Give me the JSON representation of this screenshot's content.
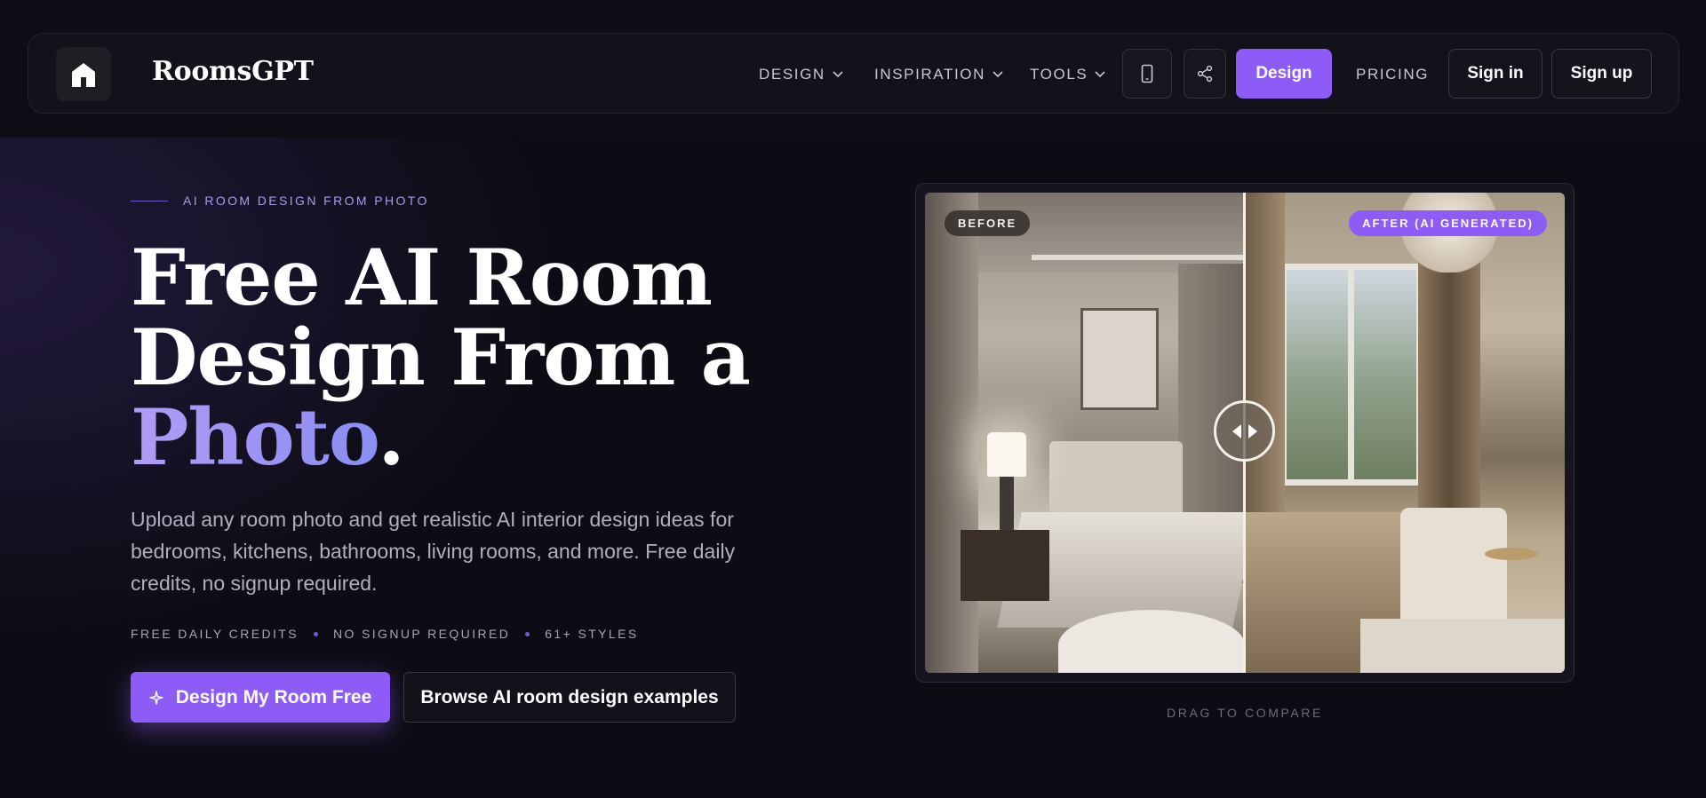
{
  "brand": {
    "name": "RoomsGPT"
  },
  "nav": {
    "items": [
      {
        "label": "DESIGN"
      },
      {
        "label": "INSPIRATION"
      },
      {
        "label": "TOOLS"
      }
    ],
    "design_button": "Design",
    "pricing": "PRICING",
    "sign_in": "Sign in",
    "sign_up": "Sign up"
  },
  "hero": {
    "eyebrow": "AI ROOM DESIGN FROM PHOTO",
    "headline_line1": "Free AI Room",
    "headline_line2": "Design From a",
    "headline_accent": "Photo",
    "headline_period": ".",
    "description": "Upload any room photo and get realistic AI interior design ideas for bedrooms, kitchens, bathrooms, living rooms, and more. Free daily credits, no signup required.",
    "badges": [
      "FREE DAILY CREDITS",
      "NO SIGNUP REQUIRED",
      "61+ STYLES"
    ],
    "cta_primary": "Design My Room Free",
    "cta_secondary": "Browse AI room design examples"
  },
  "compare": {
    "before_label": "BEFORE",
    "after_label": "AFTER (AI GENERATED)",
    "hint": "DRAG TO COMPARE"
  },
  "colors": {
    "accent": "#8d5cf6",
    "background": "#0d0c14"
  }
}
